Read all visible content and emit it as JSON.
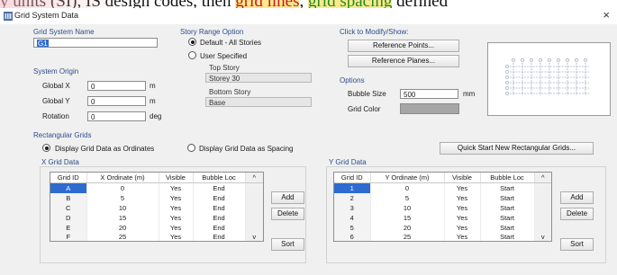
{
  "background_text": {
    "seg1": "y units (SI), IS design codes, then ",
    "seg2": "grid lines",
    "seg3": ", ",
    "seg4": "grid spacing",
    "seg5": " defined"
  },
  "window": {
    "title": "Grid System Data",
    "close_glyph": "×"
  },
  "grid_system_name": {
    "label": "Grid System Name",
    "value": "G1"
  },
  "system_origin": {
    "label": "System Origin",
    "fields": [
      {
        "label": "Global X",
        "value": "0",
        "unit": "m"
      },
      {
        "label": "Global Y",
        "value": "0",
        "unit": "m"
      },
      {
        "label": "Rotation",
        "value": "0",
        "unit": "deg"
      }
    ]
  },
  "story_range": {
    "label": "Story Range Option",
    "default_option": "Default - All Stories",
    "user_option": "User Specified",
    "selected": "default",
    "top_story_label": "Top Story",
    "top_story_value": "Storey 30",
    "bottom_story_label": "Bottom Story",
    "bottom_story_value": "Base"
  },
  "modify_show": {
    "label": "Click to Modify/Show:",
    "reference_points": "Reference Points...",
    "reference_planes": "Reference Planes..."
  },
  "options": {
    "label": "Options",
    "bubble_size_label": "Bubble Size",
    "bubble_size_value": "500",
    "bubble_size_unit": "mm",
    "grid_color_label": "Grid Color",
    "grid_color": "#a6a6a6"
  },
  "rectangular_grids": {
    "label": "Rectangular Grids",
    "ordinates_option": "Display Grid Data as Ordinates",
    "spacing_option": "Display Grid Data as Spacing",
    "selected": "ordinates",
    "quick_start": "Quick Start New Rectangular Grids..."
  },
  "x_grid": {
    "label": "X Grid Data",
    "columns": [
      "Grid ID",
      "X Ordinate (m)",
      "Visible",
      "Bubble Loc"
    ],
    "rows": [
      [
        "A",
        "0",
        "Yes",
        "End"
      ],
      [
        "B",
        "5",
        "Yes",
        "End"
      ],
      [
        "C",
        "10",
        "Yes",
        "End"
      ],
      [
        "D",
        "15",
        "Yes",
        "End"
      ],
      [
        "E",
        "20",
        "Yes",
        "End"
      ],
      [
        "F",
        "25",
        "Yes",
        "End"
      ]
    ],
    "add": "Add",
    "delete": "Delete",
    "sort": "Sort"
  },
  "y_grid": {
    "label": "Y Grid Data",
    "columns": [
      "Grid ID",
      "Y Ordinate (m)",
      "Visible",
      "Bubble Loc"
    ],
    "rows": [
      [
        "1",
        "0",
        "Yes",
        "Start"
      ],
      [
        "2",
        "5",
        "Yes",
        "Start"
      ],
      [
        "3",
        "10",
        "Yes",
        "Start"
      ],
      [
        "4",
        "15",
        "Yes",
        "Start"
      ],
      [
        "5",
        "20",
        "Yes",
        "Start"
      ],
      [
        "6",
        "25",
        "Yes",
        "Start"
      ]
    ],
    "add": "Add",
    "delete": "Delete",
    "sort": "Sort"
  },
  "colors": {
    "group_label": "#2b4d8a",
    "selection": "#2e6bd1"
  },
  "icons": {
    "app": "app-grid-icon",
    "scroll_up": "▲",
    "scroll_down": "▼",
    "header_up": "^",
    "header_down": "v"
  }
}
